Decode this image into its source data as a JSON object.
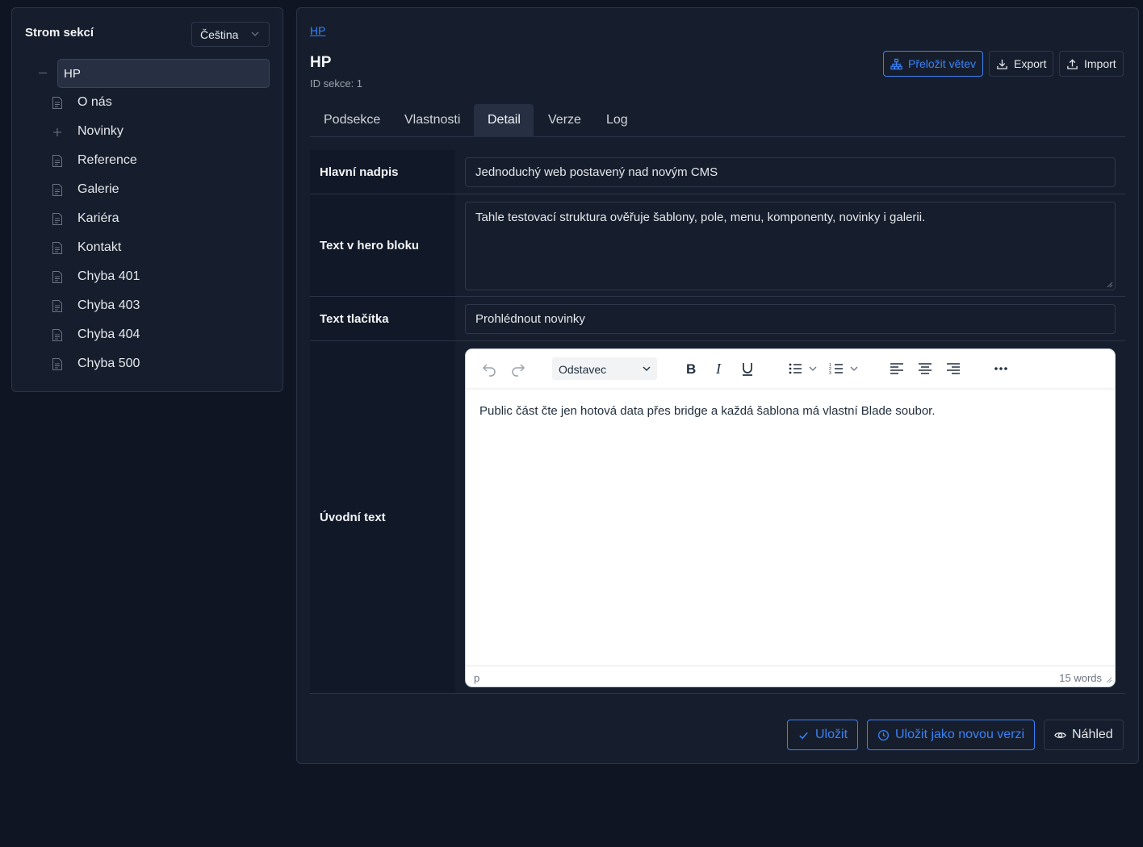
{
  "sidebar": {
    "title": "Strom sekcí",
    "language": "Čeština",
    "root": "HP",
    "items": [
      {
        "label": "O nás",
        "icon": "page-icon"
      },
      {
        "label": "Novinky",
        "icon": "plus-icon"
      },
      {
        "label": "Reference",
        "icon": "page-icon"
      },
      {
        "label": "Galerie",
        "icon": "page-icon"
      },
      {
        "label": "Kariéra",
        "icon": "page-icon"
      },
      {
        "label": "Kontakt",
        "icon": "page-icon"
      },
      {
        "label": "Chyba 401",
        "icon": "page-icon"
      },
      {
        "label": "Chyba 403",
        "icon": "page-icon"
      },
      {
        "label": "Chyba 404",
        "icon": "page-icon"
      },
      {
        "label": "Chyba 500",
        "icon": "page-icon"
      }
    ]
  },
  "header": {
    "breadcrumb": "HP",
    "title": "HP",
    "subtitle": "ID sekce: 1",
    "actions": {
      "translate": "Přeložit větev",
      "export": "Export",
      "import": "Import"
    }
  },
  "tabs": [
    "Podsekce",
    "Vlastnosti",
    "Detail",
    "Verze",
    "Log"
  ],
  "active_tab": "Detail",
  "form": {
    "headline_label": "Hlavní nadpis",
    "headline_value": "Jednoduchý web postavený nad novým CMS",
    "hero_label": "Text v hero bloku",
    "hero_value": "Tahle testovací struktura ověřuje šablony, pole, menu, komponenty, novinky i galerii.",
    "button_label": "Text tlačítka",
    "button_value": "Prohlédnout novinky",
    "intro_label": "Úvodní text",
    "editor": {
      "format": "Odstavec",
      "content": "Public část čte jen hotová data přes bridge a každá šablona má vlastní Blade soubor.",
      "path": "p",
      "word_count": "15 words"
    }
  },
  "footer": {
    "save": "Uložit",
    "save_version": "Uložit jako novou verzi",
    "preview": "Náhled"
  },
  "colors": {
    "accent": "#3b82f6",
    "background": "#0f1522",
    "panel": "#161e2d"
  }
}
